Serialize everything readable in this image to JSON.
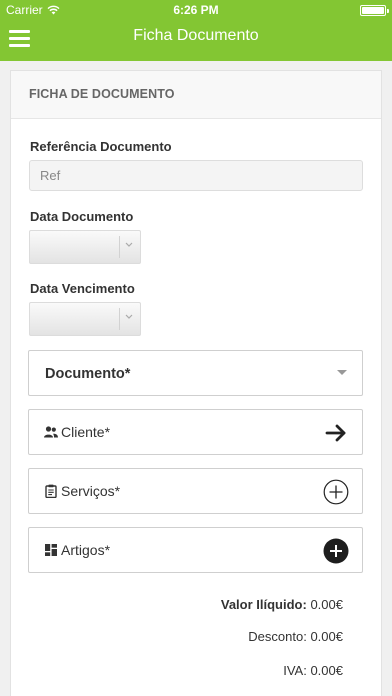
{
  "status_bar": {
    "carrier": "Carrier",
    "time": "6:26 PM"
  },
  "nav": {
    "title": "Ficha Documento",
    "menu_icon": "hamburger-menu-icon"
  },
  "card": {
    "header": "FICHA DE DOCUMENTO"
  },
  "form": {
    "referencia_label": "Referência Documento",
    "referencia_placeholder": "Ref",
    "referencia_value": "",
    "data_documento_label": "Data Documento",
    "data_vencimento_label": "Data Vencimento"
  },
  "sections": {
    "documento": "Documento*",
    "cliente": "Cliente*",
    "servicos": "Serviços*",
    "artigos": "Artigos*"
  },
  "totals": {
    "valor_label": "Valor Ilíquido:",
    "valor_value": "0.00€",
    "desconto_label": "Desconto:",
    "desconto_value": "0.00€",
    "iva_label": "IVA:",
    "iva_value": "0.00€"
  },
  "colors": {
    "brand": "#83c633"
  }
}
